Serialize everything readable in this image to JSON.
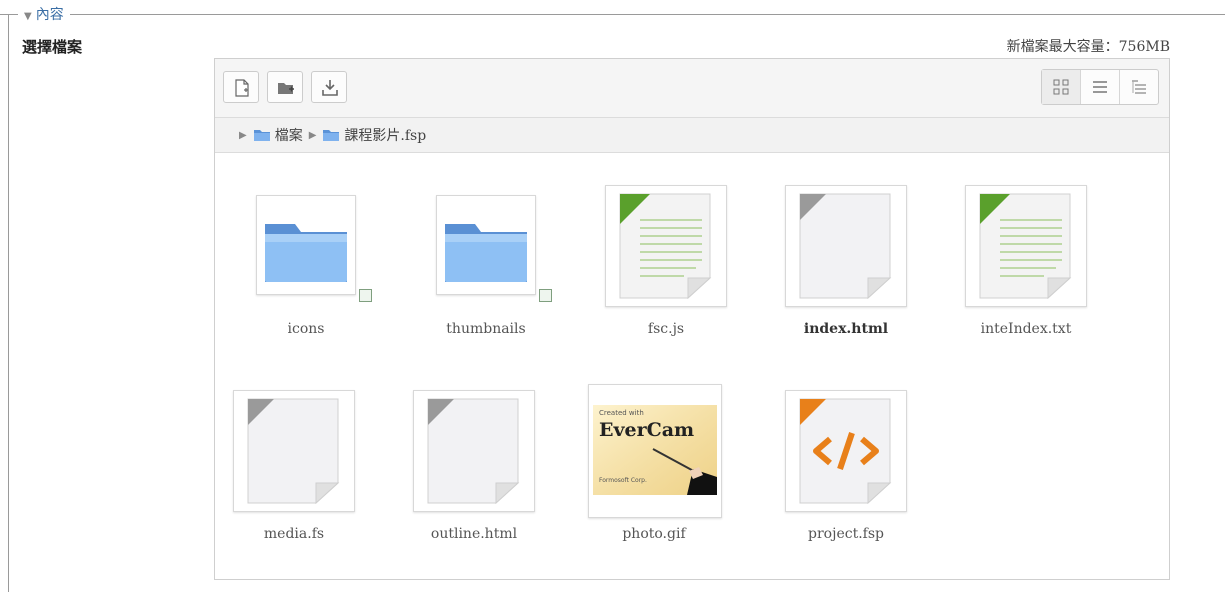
{
  "legend": {
    "label": "內容"
  },
  "field": {
    "label": "選擇檔案",
    "max_size": "新檔案最大容量：756MB"
  },
  "toolbar": {
    "icons": [
      "add-file-icon",
      "create-folder-icon",
      "download-icon"
    ],
    "views": [
      "icon-view-icon",
      "list-view-icon",
      "tree-view-icon"
    ]
  },
  "path": {
    "root": "檔案",
    "current": "課程影片.fsp"
  },
  "files": [
    {
      "name": "icons",
      "type": "folder"
    },
    {
      "name": "thumbnails",
      "type": "folder"
    },
    {
      "name": "fsc.js",
      "type": "text"
    },
    {
      "name": "index.html",
      "type": "document"
    },
    {
      "name": "inteIndex.txt",
      "type": "text"
    },
    {
      "name": "media.fs",
      "type": "document"
    },
    {
      "name": "outline.html",
      "type": "document"
    },
    {
      "name": "photo.gif",
      "type": "image"
    },
    {
      "name": "project.fsp",
      "type": "code"
    }
  ],
  "photo_thumb": {
    "line1": "Created with",
    "brand": "EverCam",
    "line3": "Formosoft Corp."
  },
  "colors": {
    "accent": "#3a6ea5",
    "folder": "#6fa8e8",
    "green": "#5aa02c",
    "orange": "#e8801a"
  }
}
